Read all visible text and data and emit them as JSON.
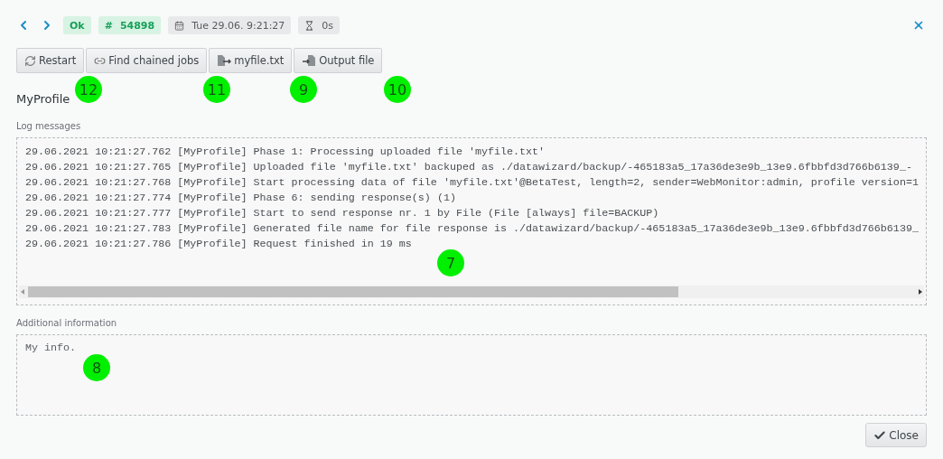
{
  "header": {
    "badges": [
      {
        "kind": "status",
        "text": "Ok"
      },
      {
        "kind": "id",
        "prefix": "#",
        "text": "54898"
      },
      {
        "kind": "date",
        "text": "Tue 29.06. 9:21:27"
      },
      {
        "kind": "duration",
        "text": "0s"
      }
    ]
  },
  "toolbar": [
    {
      "kind": "restart",
      "label": "Restart"
    },
    {
      "kind": "link",
      "label": "Find chained jobs"
    },
    {
      "kind": "input",
      "label": "myfile.txt"
    },
    {
      "kind": "output",
      "label": "Output file"
    }
  ],
  "profile": "MyProfile",
  "log": {
    "label": "Log messages",
    "lines": [
      "29.06.2021 10:21:27.762 [MyProfile] Phase 1: Processing uploaded file 'myfile.txt'",
      "29.06.2021 10:21:27.765 [MyProfile] Uploaded file 'myfile.txt' backuped as ./datawizard/backup/-465183a5_17a36de3e9b_13e9.6fbbfd3d766b6139_-",
      "29.06.2021 10:21:27.768 [MyProfile] Start processing data of file 'myfile.txt'@BetaTest, length=2, sender=WebMonitor:admin, profile version=1",
      "29.06.2021 10:21:27.774 [MyProfile] Phase 6: sending response(s) (1)",
      "29.06.2021 10:21:27.777 [MyProfile] Start to send response nr. 1 by File (File [always] file=BACKUP)",
      "29.06.2021 10:21:27.783 [MyProfile] Generated file name for file response is ./datawizard/backup/-465183a5_17a36de3e9b_13e9.6fbbfd3d766b6139_",
      "29.06.2021 10:21:27.786 [MyProfile] Request finished in 19 ms"
    ]
  },
  "additional": {
    "label": "Additional information",
    "value": "My info."
  },
  "close_button": "Close",
  "markers": [
    {
      "label": "12"
    },
    {
      "label": "11"
    },
    {
      "label": "9"
    },
    {
      "label": "10"
    },
    {
      "label": "7"
    },
    {
      "label": "8"
    }
  ]
}
